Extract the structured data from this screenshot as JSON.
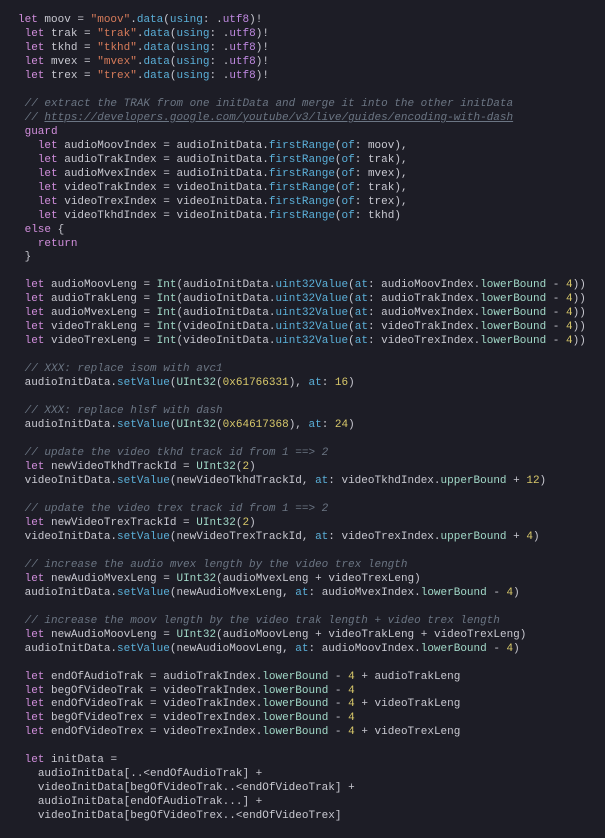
{
  "s1": {
    "m": "moov",
    "t": "trak",
    "k": "tkhd",
    "v": "mvex",
    "x": "trex"
  },
  "cm1": "// extract the TRAK from one initData and merge it into the other initData",
  "cm2a": "// ",
  "cm2b": "https://developers.google.com/youtube/v3/live/guides/encoding-with-dash",
  "g": {
    "a": "audioMoovIndex",
    "b": "audioTrakIndex",
    "c": "audioMvexIndex",
    "d": "videoTrakIndex",
    "e": "videoTrexIndex",
    "f": "videoTkhdIndex",
    "src": {
      "a": "audioInitData",
      "v": "videoInitData"
    },
    "of": {
      "a": "moov",
      "b": "trak",
      "c": "mvex",
      "d": "trak",
      "e": "trex",
      "f": "tkhd"
    }
  },
  "len": {
    "a": "audioMoovLeng",
    "b": "audioTrakLeng",
    "c": "audioMvexLeng",
    "d": "videoTrakLeng",
    "e": "videoTrexLeng",
    "idx": {
      "a": "audioMoovIndex",
      "b": "audioTrakIndex",
      "c": "audioMvexIndex",
      "d": "videoTrakIndex",
      "e": "videoTrexIndex"
    }
  },
  "cm3": "// XXX: replace isom with avc1",
  "hex1": "0x61766331",
  "off1": "16",
  "cm4": "// XXX: replace hlsf with dash",
  "hex2": "0x64617368",
  "off2": "24",
  "cm5": "// update the video tkhd track id from 1 ==> 2",
  "tk": {
    "name": "newVideoTkhdTrackId",
    "val": "2",
    "off": "12",
    "idx": "videoTkhdIndex"
  },
  "cm6": "// update the video trex track id from 1 ==> 2",
  "tx": {
    "name": "newVideoTrexTrackId",
    "val": "2",
    "off": "4",
    "idx": "videoTrexIndex"
  },
  "cm7": "// increase the audio mvex length by the video trex length",
  "mv": {
    "name": "newAudioMvexLeng",
    "a": "audioMvexLeng",
    "b": "videoTrexLeng",
    "idx": "audioMvexIndex"
  },
  "cm8": "// increase the moov length by the video trak length + video trex length",
  "mo": {
    "name": "newAudioMoovLeng",
    "a": "audioMoovLeng",
    "b": "videoTrakLeng",
    "c": "videoTrexLeng",
    "idx": "audioMoovIndex"
  },
  "e": {
    "a": "endOfAudioTrak",
    "ai": "audioTrakIndex",
    "al": "audioTrakLeng",
    "b": "begOfVideoTrak",
    "bi": "videoTrakIndex",
    "c": "endOfVideoTrak",
    "ci": "videoTrakIndex",
    "cl": "videoTrakLeng",
    "d": "begOfVideoTrex",
    "di": "videoTrexIndex",
    "e": "endOfVideoTrex",
    "ei": "videoTrexIndex",
    "el": "videoTrexLeng"
  },
  "init": {
    "name": "initData",
    "l1a": "audioInitData[..<",
    "l1b": "endOfAudioTrak",
    "l1c": "] +",
    "l2a": "videoInitData[",
    "l2b": "begOfVideoTrak",
    "l2c": "..<",
    "l2d": "endOfVideoTrak",
    "l2e": "] +",
    "l3a": "audioInitData[",
    "l3b": "endOfAudioTrak",
    "l3c": "...] +",
    "l4a": "videoInitData[",
    "l4b": "begOfVideoTrex",
    "l4c": "..<",
    "l4d": "endOfVideoTrex",
    "l4e": "]"
  },
  "n4": "4"
}
